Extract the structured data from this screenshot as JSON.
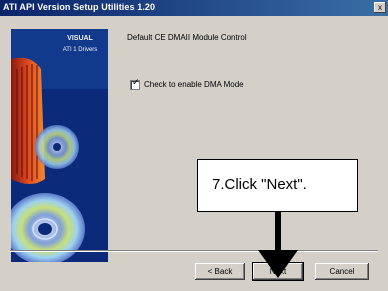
{
  "window": {
    "title": "ATI API Version Setup Utilities 1.20",
    "title_button": "x"
  },
  "banner": {
    "title": "VISUAL",
    "subtitle": "ATI 1 Drivers"
  },
  "main": {
    "heading": "Default CE DMAII Module Control",
    "checkbox_label": "Check to enable DMA Mode",
    "checkbox_checked": true
  },
  "buttons": {
    "back_label": "< Back",
    "next_label": "Next",
    "cancel_label": "Cancel"
  },
  "callout": {
    "text": "7.Click \"Next\"."
  },
  "colors": {
    "titlebar": "#0a246a",
    "dialog_bg": "#d4d0c8",
    "banner_bg": "#0b2a7a",
    "arrow": "#000000"
  }
}
